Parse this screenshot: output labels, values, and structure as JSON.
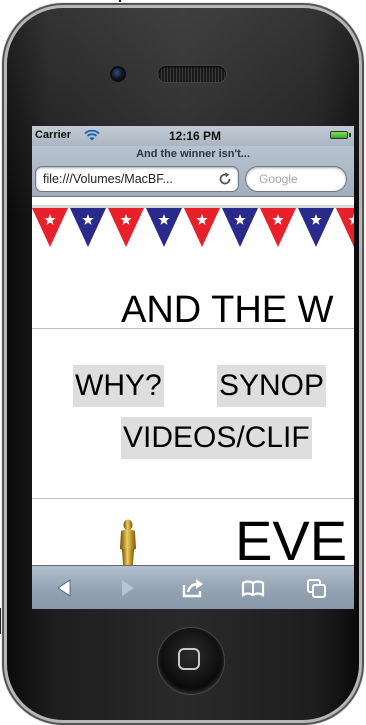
{
  "status_bar": {
    "carrier": "Carrier",
    "time": "12:16 PM",
    "icons": [
      "wifi-icon",
      "battery-icon"
    ]
  },
  "browser": {
    "page_title": "And the winner isn't...",
    "url": "file:///Volumes/MacBF...",
    "search_placeholder": "Google"
  },
  "page": {
    "headline": "AND THE W",
    "nav_links": [
      "WHY?",
      "SYNOP",
      "VIDEOS/CLIF"
    ],
    "section_text": "EVE",
    "bunting_colors": [
      "#e8202a",
      "#2a2a8c"
    ]
  },
  "toolbar": {
    "icons": [
      "back-arrow-icon",
      "forward-arrow-icon",
      "share-icon",
      "bookmarks-icon",
      "tabs-icon"
    ]
  }
}
